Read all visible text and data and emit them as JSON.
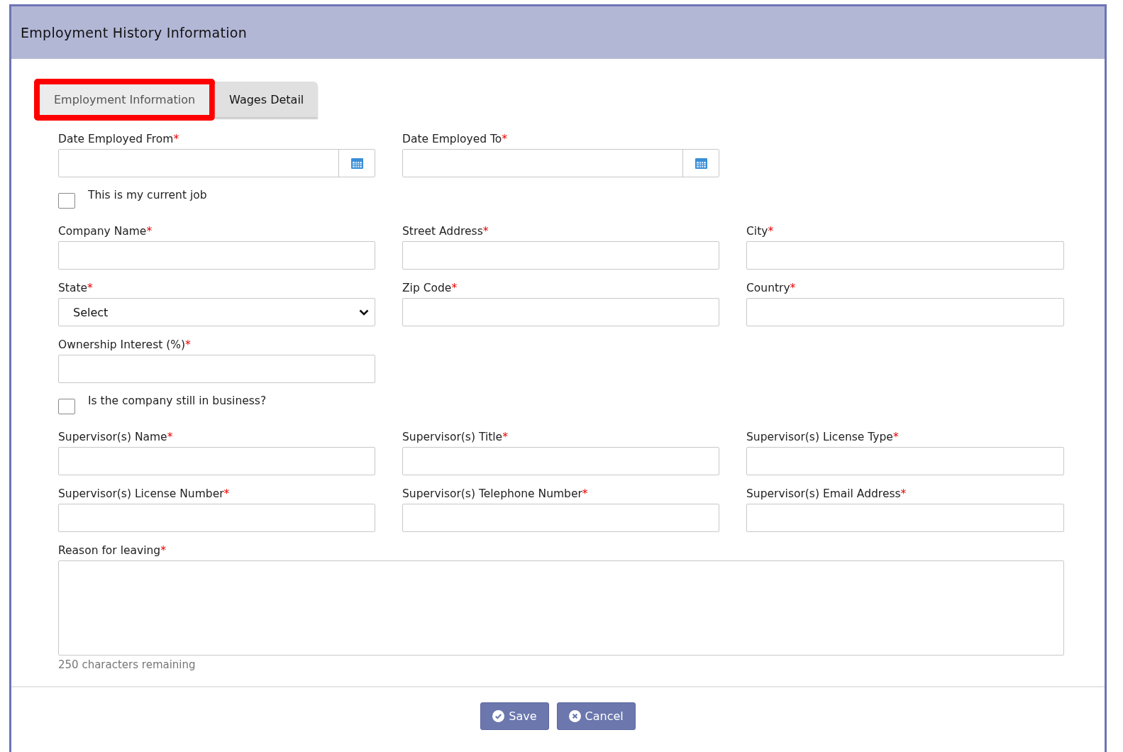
{
  "panel": {
    "title": "Employment History Information"
  },
  "tabs": [
    {
      "label": "Employment Information",
      "selected": true
    },
    {
      "label": "Wages Detail",
      "selected": false
    }
  ],
  "rows": [
    {
      "kind": "fields",
      "fields": [
        {
          "kind": "date",
          "label": "Date Employed From",
          "required_mark": "*"
        },
        {
          "kind": "date",
          "label": "Date Employed To",
          "required_mark": "*"
        }
      ]
    },
    {
      "kind": "checkbox",
      "label": "This is my current job",
      "checked": false
    },
    {
      "kind": "fields",
      "fields": [
        {
          "kind": "text",
          "label": "Company Name",
          "required_mark": "*"
        },
        {
          "kind": "text",
          "label": "Street Address",
          "required_mark": "*"
        },
        {
          "kind": "text",
          "label": "City",
          "required_mark": "*"
        }
      ]
    },
    {
      "kind": "fields",
      "fields": [
        {
          "kind": "select",
          "label": "State",
          "required_mark": "*",
          "value": "Select"
        },
        {
          "kind": "text",
          "label": "Zip Code",
          "required_mark": "*"
        },
        {
          "kind": "text",
          "label": "Country",
          "required_mark": "*"
        }
      ]
    },
    {
      "kind": "fields",
      "fields": [
        {
          "kind": "text",
          "label": "Ownership Interest (%)",
          "required_mark": "*"
        }
      ]
    },
    {
      "kind": "checkbox",
      "label": "Is the company still in business?",
      "checked": false
    },
    {
      "kind": "fields",
      "fields": [
        {
          "kind": "text",
          "label": "Supervisor(s) Name",
          "required_mark": "*"
        },
        {
          "kind": "text",
          "label": "Supervisor(s) Title",
          "required_mark": "*"
        },
        {
          "kind": "text",
          "label": "Supervisor(s) License Type",
          "required_mark": "*"
        }
      ]
    },
    {
      "kind": "fields",
      "fields": [
        {
          "kind": "text",
          "label": "Supervisor(s) License Number",
          "required_mark": "*"
        },
        {
          "kind": "text",
          "label": "Supervisor(s) Telephone Number",
          "required_mark": "*"
        },
        {
          "kind": "text",
          "label": "Supervisor(s) Email Address",
          "required_mark": "*"
        }
      ]
    },
    {
      "kind": "textarea",
      "label": "Reason for leaving",
      "required_mark": "*",
      "counter": "250 characters remaining"
    }
  ],
  "buttons": [
    {
      "kind": "save",
      "label": "Save"
    },
    {
      "kind": "cancel",
      "label": "Cancel"
    }
  ]
}
